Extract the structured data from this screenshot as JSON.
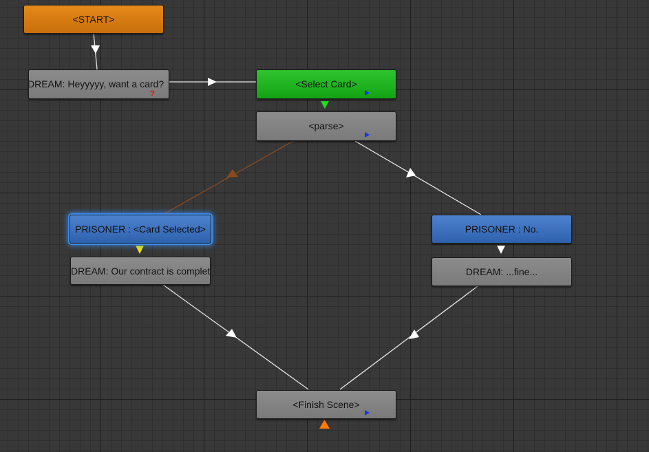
{
  "graph": {
    "nodes": {
      "start": "<START>",
      "dream_hey": "DREAM: Heyyyyy, want a card?",
      "select_card": "<Select Card>",
      "parse": "<parse>",
      "prisoner_card": "PRISONER : <Card Selected>",
      "prisoner_no": "PRISONER : No.",
      "dream_contract": "DREAM: Our contract is complete.",
      "dream_fine": "DREAM: ...fine...",
      "finish": "<Finish Scene>"
    },
    "question_mark": "?"
  },
  "colors": {
    "canvas": "#383838",
    "node_gray": "#828282",
    "node_orange": "#d97b12",
    "node_green": "#1fb31f",
    "node_blue": "#3d72be",
    "wire": "#e6e6e6",
    "wire_selected": "#8a4a1e",
    "port": "#1a34e0",
    "selection_glow": "#3c8ef0"
  }
}
